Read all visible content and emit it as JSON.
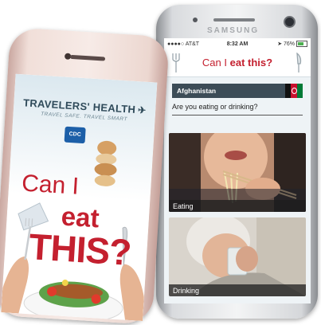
{
  "samsung_phone": {
    "brand": "SAMSUNG",
    "status_bar": {
      "carrier": "AT&T",
      "time": "8:32 AM",
      "battery": "76%"
    },
    "app_title_prefix": "Can I ",
    "app_title_bold": "eat this?",
    "country": "Afghanistan",
    "question": "Are you eating or drinking?",
    "options": [
      {
        "label": "Eating"
      },
      {
        "label": "Drinking"
      }
    ]
  },
  "iphone": {
    "title": "TRAVELERS' HEALTH",
    "subtitle": "TRAVEL SAFE. TRAVEL SMART",
    "logo_text": "CDC",
    "splash_line1": "Can I",
    "splash_line2": "eat",
    "splash_line3": "THIS?"
  },
  "colors": {
    "brand_red": "#c4202f",
    "header_dark": "#3c4c57",
    "cdc_blue": "#1c5fa8"
  }
}
